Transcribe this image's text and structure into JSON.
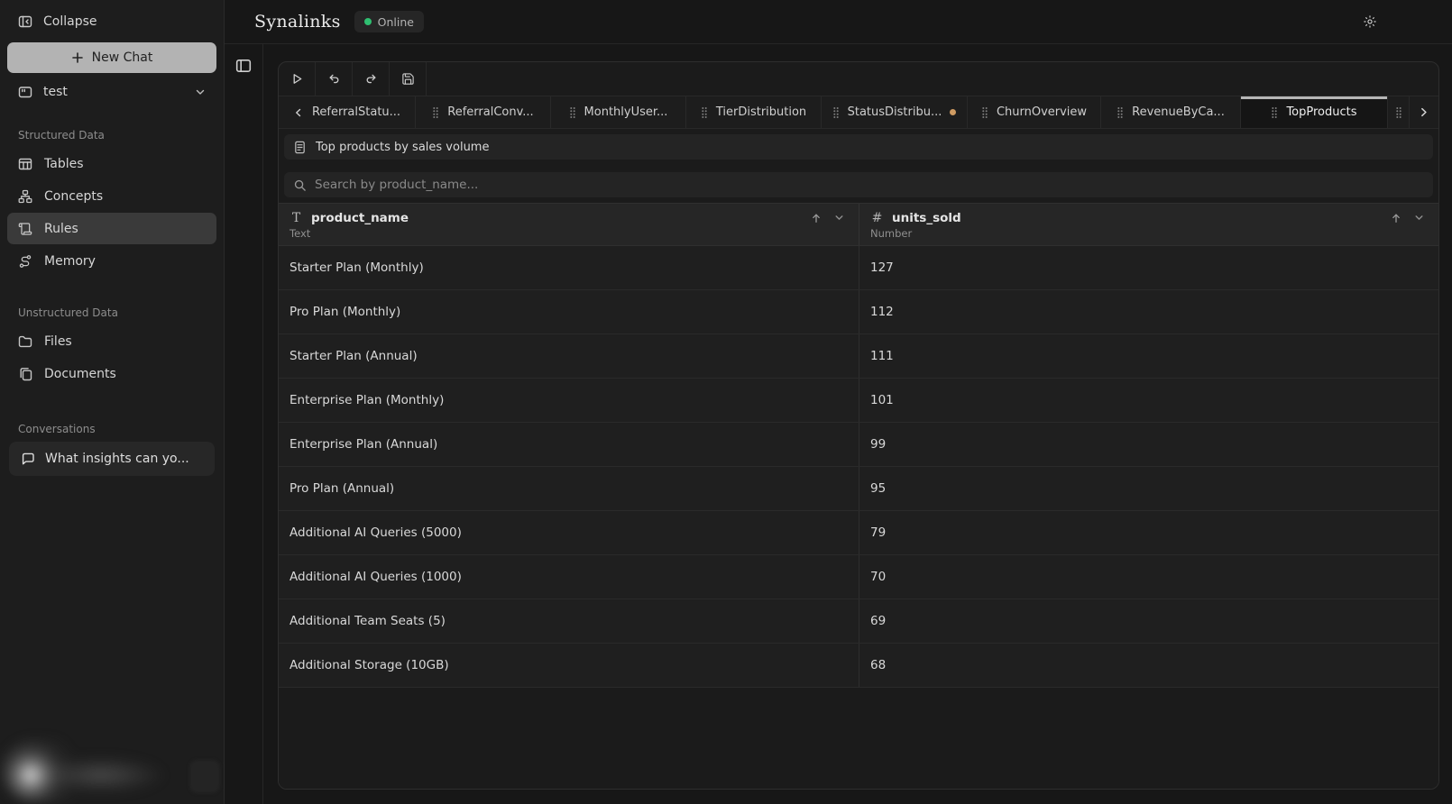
{
  "header": {
    "title": "Synalinks",
    "online_label": "Online"
  },
  "sidebar": {
    "collapse_label": "Collapse",
    "new_chat_label": "New Chat",
    "project_name": "test",
    "sections": [
      {
        "label": "Structured Data",
        "items": [
          {
            "label": "Tables"
          },
          {
            "label": "Concepts"
          },
          {
            "label": "Rules"
          },
          {
            "label": "Memory"
          }
        ]
      },
      {
        "label": "Unstructured Data",
        "items": [
          {
            "label": "Files"
          },
          {
            "label": "Documents"
          }
        ]
      }
    ],
    "conversations": {
      "label": "Conversations",
      "items": [
        {
          "label": "What insights can yo..."
        }
      ]
    }
  },
  "tabs": [
    {
      "label": "ReferralStatu..."
    },
    {
      "label": "ReferralConv..."
    },
    {
      "label": "MonthlyUser..."
    },
    {
      "label": "TierDistribution"
    },
    {
      "label": "StatusDistribu...",
      "unsaved": true
    },
    {
      "label": "ChurnOverview"
    },
    {
      "label": "RevenueByCa..."
    },
    {
      "label": "TopProducts",
      "active": true
    }
  ],
  "view": {
    "description": "Top products by sales volume",
    "search_placeholder": "Search by product_name..."
  },
  "table": {
    "columns": [
      {
        "name": "product_name",
        "type": "Text",
        "type_glyph": "T"
      },
      {
        "name": "units_sold",
        "type": "Number",
        "type_glyph": "#"
      }
    ],
    "rows": [
      [
        "Starter Plan (Monthly)",
        "127"
      ],
      [
        "Pro Plan (Monthly)",
        "112"
      ],
      [
        "Starter Plan (Annual)",
        "111"
      ],
      [
        "Enterprise Plan (Monthly)",
        "101"
      ],
      [
        "Enterprise Plan (Annual)",
        "99"
      ],
      [
        "Pro Plan (Annual)",
        "95"
      ],
      [
        "Additional AI Queries (5000)",
        "79"
      ],
      [
        "Additional AI Queries (1000)",
        "70"
      ],
      [
        "Additional Team Seats (5)",
        "69"
      ],
      [
        "Additional Storage (10GB)",
        "68"
      ]
    ]
  },
  "colors": {
    "online_dot": "#2fbf71",
    "unsaved_dot": "#cf9b62",
    "active_tab_accent": "#b6b6b6"
  }
}
